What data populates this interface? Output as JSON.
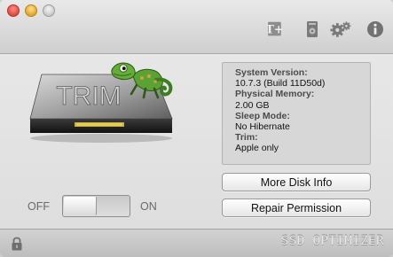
{
  "toolbar": {
    "icons": [
      "trim-plus-icon",
      "disk-icon",
      "gears-icon",
      "info-icon"
    ],
    "trim_icon_text": "T+"
  },
  "drive": {
    "label": "TRIM"
  },
  "system_info": {
    "system_version_label": "System Version:",
    "system_version_value": "10.7.3 (Build 11D50d)",
    "physical_memory_label": "Physical Memory:",
    "physical_memory_value": "2.00 GB",
    "sleep_mode_label": "Sleep Mode:",
    "sleep_mode_value": "No Hibernate",
    "trim_label": "Trim:",
    "trim_value": "Apple only"
  },
  "buttons": {
    "more_disk_info": "More Disk Info",
    "repair_permission": "Repair Permission"
  },
  "toggle": {
    "off_label": "OFF",
    "on_label": "ON",
    "state": "off"
  },
  "footer": {
    "brand": "SSD OPTIMIZER"
  },
  "colors": {
    "window_bg": "#e4e4e4",
    "panel_bg": "#d7d7d7",
    "gecko_green": "#4f9a2c"
  }
}
